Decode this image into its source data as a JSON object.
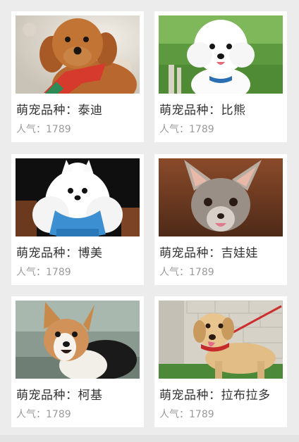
{
  "cards": [
    {
      "breed": "萌宠品种：泰迪",
      "popularity": "人气：1789",
      "photo": "teddy-dog-photo"
    },
    {
      "breed": "萌宠品种：比熊",
      "popularity": "人气：1789",
      "photo": "bichon-dog-photo"
    },
    {
      "breed": "萌宠品种：博美",
      "popularity": "人气：1789",
      "photo": "pomeranian-dog-photo"
    },
    {
      "breed": "萌宠品种：吉娃娃",
      "popularity": "人气：1789",
      "photo": "chihuahua-dog-photo"
    },
    {
      "breed": "萌宠品种：柯基",
      "popularity": "人气：1789",
      "photo": "corgi-dog-photo"
    },
    {
      "breed": "萌宠品种：拉布拉多",
      "popularity": "人气：1789",
      "photo": "labrador-dog-photo"
    }
  ]
}
